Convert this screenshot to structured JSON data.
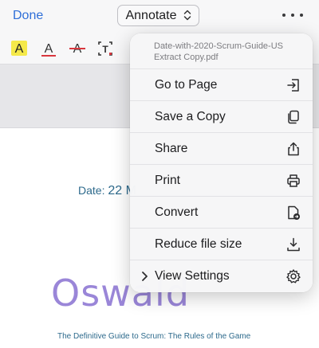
{
  "toolbar": {
    "done_label": "Done",
    "mode_value": "Annotate",
    "tools": [
      {
        "name": "highlight-text-tool",
        "glyph": "A"
      },
      {
        "name": "underline-text-tool",
        "glyph": "A"
      },
      {
        "name": "strikethrough-text-tool",
        "glyph": "A"
      },
      {
        "name": "textbox-tool",
        "glyph": "T"
      }
    ]
  },
  "document": {
    "date_prefix": "Date: ",
    "date_value": "22 M",
    "name": "Oswald",
    "subtitle": "The Definitive Guide to Scrum: The Rules of the Game"
  },
  "menu": {
    "file_name_line1": "Date-with-2020-Scrum-Guide-US",
    "file_name_line2": "Extract Copy.pdf",
    "items": [
      {
        "label": "Go to Page",
        "icon": "go-to-page-icon"
      },
      {
        "label": "Save a Copy",
        "icon": "copy-icon"
      },
      {
        "label": "Share",
        "icon": "share-icon"
      },
      {
        "label": "Print",
        "icon": "print-icon"
      },
      {
        "label": "Convert",
        "icon": "convert-icon"
      },
      {
        "label": "Reduce file size",
        "icon": "download-icon"
      },
      {
        "label": "View Settings",
        "icon": "gear-icon"
      }
    ]
  },
  "colors": {
    "accent": "#2f6fd8",
    "highlight": "#f5e94a",
    "underline": "#d9363e",
    "doc_text": "#2d6a8c",
    "doc_name": "#9a86d8"
  }
}
